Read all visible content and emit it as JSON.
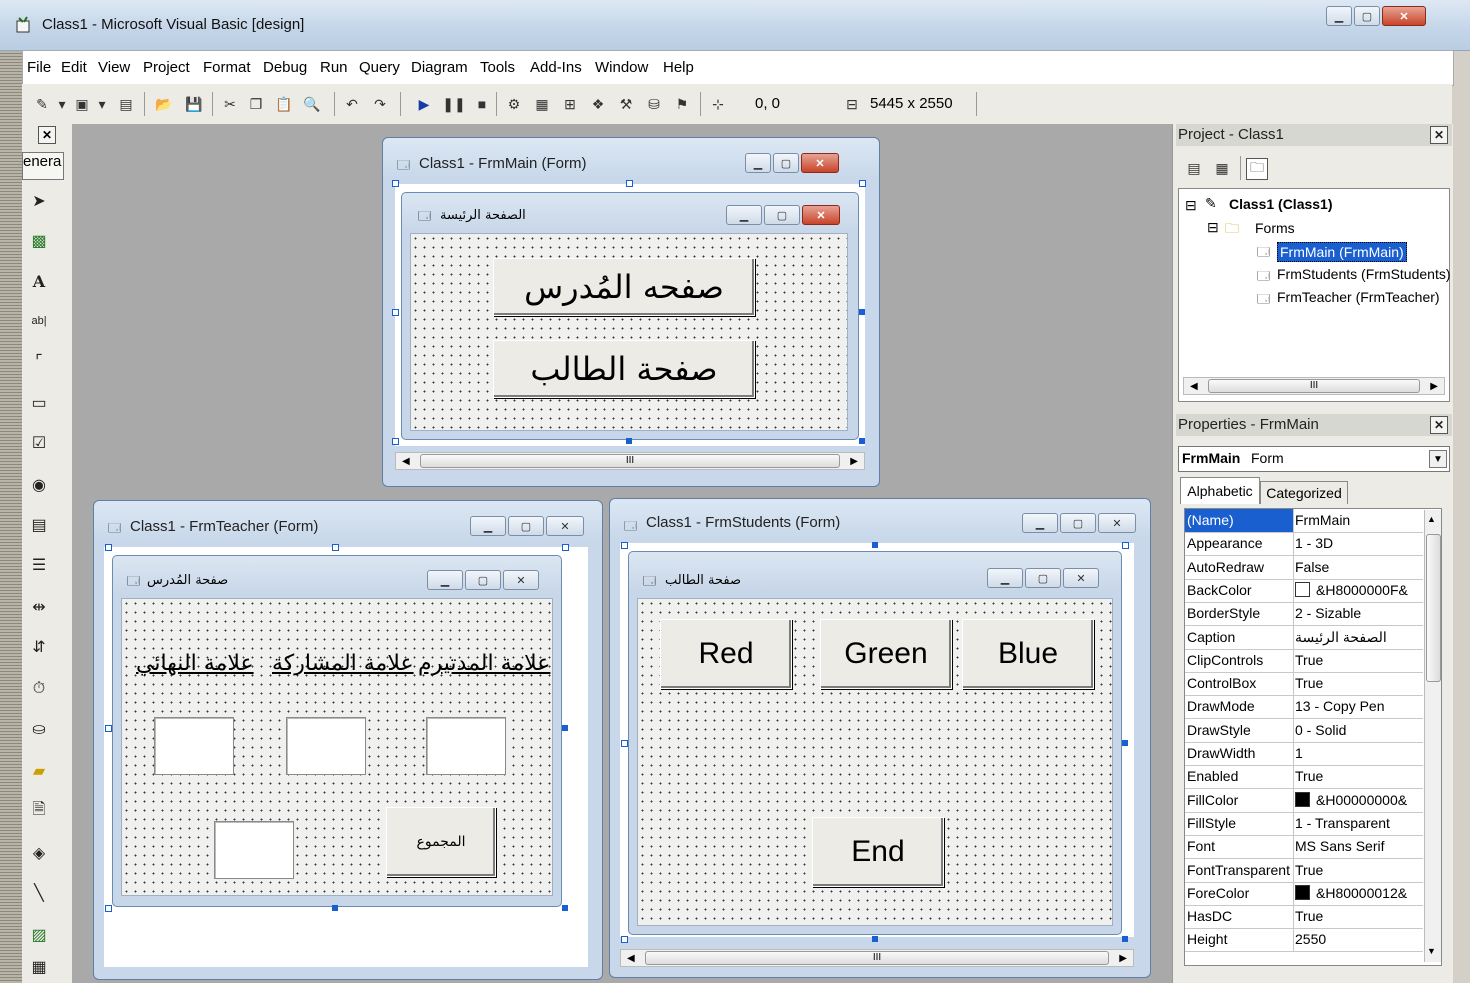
{
  "app": {
    "title": "Class1 - Microsoft Visual Basic [design]"
  },
  "menu": [
    "File",
    "Edit",
    "View",
    "Project",
    "Format",
    "Debug",
    "Run",
    "Query",
    "Diagram",
    "Tools",
    "Add-Ins",
    "Window",
    "Help"
  ],
  "toolbar": {
    "coords": "0, 0",
    "size": "5445 x 2550"
  },
  "toolbox": {
    "tab_label": "enera"
  },
  "frm_main": {
    "title": "Class1 - FrmMain (Form)",
    "caption": "الصفحة الرئيسة",
    "btn_teacher": "صفحه المُدرس",
    "btn_student": "صفحة الطالب",
    "scroll_thumb": "III"
  },
  "frm_teacher": {
    "title": "Class1 - FrmTeacher (Form)",
    "caption": "صفحة المُدرس",
    "label_midterm": "علامة المدتيرم",
    "label_participation": "علامة المشاركة",
    "label_final": "علامة النهائي",
    "btn_total": "المجموع"
  },
  "frm_students": {
    "title": "Class1 - FrmStudents (Form)",
    "caption": "صفحة الطالب",
    "btn_red": "Red",
    "btn_green": "Green",
    "btn_blue": "Blue",
    "btn_end": "End",
    "scroll_thumb": "III"
  },
  "project": {
    "title": "Project - Class1",
    "root": "Class1 (Class1)",
    "folder": "Forms",
    "items": [
      "FrmMain (FrmMain)",
      "FrmStudents (FrmStudents)",
      "FrmTeacher (FrmTeacher)"
    ],
    "scroll_thumb": "III"
  },
  "properties": {
    "title": "Properties - FrmMain",
    "object_name": "FrmMain",
    "object_type": "Form",
    "tab_alphabetic": "Alphabetic",
    "tab_categorized": "Categorized",
    "rows": [
      {
        "name": "(Name)",
        "value": "FrmMain"
      },
      {
        "name": "Appearance",
        "value": "1 - 3D"
      },
      {
        "name": "AutoRedraw",
        "value": "False"
      },
      {
        "name": "BackColor",
        "value": "&H8000000F&"
      },
      {
        "name": "BorderStyle",
        "value": "2 - Sizable"
      },
      {
        "name": "Caption",
        "value": "الصفحة الرئيسة"
      },
      {
        "name": "ClipControls",
        "value": "True"
      },
      {
        "name": "ControlBox",
        "value": "True"
      },
      {
        "name": "DrawMode",
        "value": "13 - Copy Pen"
      },
      {
        "name": "DrawStyle",
        "value": "0 - Solid"
      },
      {
        "name": "DrawWidth",
        "value": "1"
      },
      {
        "name": "Enabled",
        "value": "True"
      },
      {
        "name": "FillColor",
        "value": "&H00000000&"
      },
      {
        "name": "FillStyle",
        "value": "1 - Transparent"
      },
      {
        "name": "Font",
        "value": "MS Sans Serif"
      },
      {
        "name": "FontTransparent",
        "value": "True"
      },
      {
        "name": "ForeColor",
        "value": "&H80000012&"
      },
      {
        "name": "HasDC",
        "value": "True"
      },
      {
        "name": "Height",
        "value": "2550"
      }
    ]
  },
  "colors": {
    "selection": "#1a5fd0",
    "backcolor_swatch": "#ffffff",
    "fillcolor_swatch": "#000000",
    "forecolor_swatch": "#000000"
  }
}
